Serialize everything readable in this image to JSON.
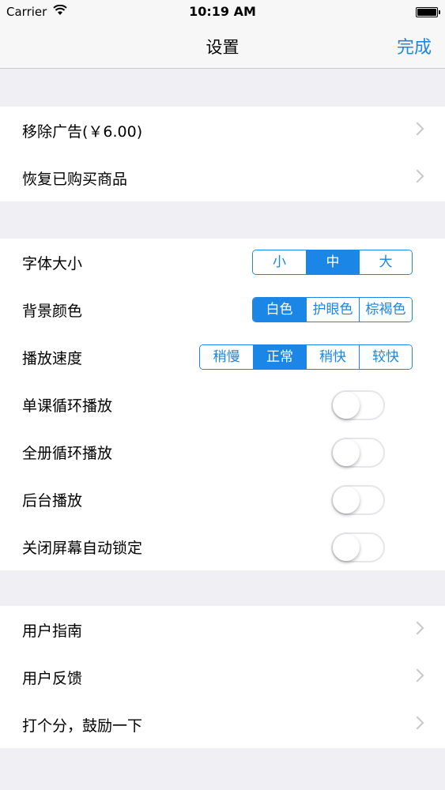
{
  "status_bar": {
    "carrier": "Carrier",
    "time": "10:19 AM"
  },
  "nav": {
    "title": "设置",
    "done_label": "完成"
  },
  "group1": [
    {
      "label": "移除广告(￥6.00)"
    },
    {
      "label": "恢复已购买商品"
    }
  ],
  "group2": {
    "font_size": {
      "label": "字体大小",
      "options": [
        "小",
        "中",
        "大"
      ],
      "selected": "中"
    },
    "bg_color": {
      "label": "背景颜色",
      "options": [
        "白色",
        "护眼色",
        "棕褐色"
      ],
      "selected": "白色"
    },
    "speed": {
      "label": "播放速度",
      "options": [
        "稍慢",
        "正常",
        "稍快",
        "较快"
      ],
      "selected": "正常"
    },
    "toggles": [
      {
        "label": "单课循环播放",
        "on": false
      },
      {
        "label": "全册循环播放",
        "on": false
      },
      {
        "label": "后台播放",
        "on": false
      },
      {
        "label": "关闭屏幕自动锁定",
        "on": false
      }
    ]
  },
  "group3": [
    {
      "label": "用户指南"
    },
    {
      "label": "用户反馈"
    },
    {
      "label": "打个分，鼓励一下"
    }
  ],
  "colors": {
    "accent": "#1b86e5",
    "background": "#efeff4",
    "toggle_border": "#e5e5ea"
  }
}
